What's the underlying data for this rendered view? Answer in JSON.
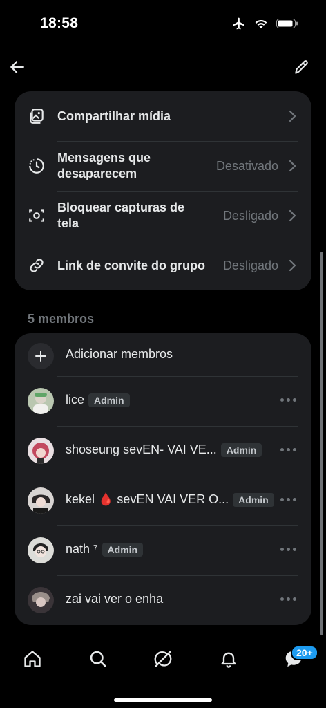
{
  "status_bar": {
    "time": "18:58",
    "icons": [
      "airplane-icon",
      "wifi-icon",
      "battery-icon"
    ]
  },
  "top_bar": {
    "back_icon": "arrow-left-icon",
    "edit_icon": "pencil-icon"
  },
  "settings": [
    {
      "label": "Compartilhar mídia",
      "value": "",
      "icon": "media-icon"
    },
    {
      "label": "Mensagens que desaparecem",
      "value": "Desativado",
      "icon": "timer-icon"
    },
    {
      "label": "Bloquear capturas de tela",
      "value": "Desligado",
      "icon": "camera-block-icon"
    },
    {
      "label": "Link de convite do grupo",
      "value": "Desligado",
      "icon": "link-icon"
    }
  ],
  "members": {
    "count_label": "5 membros",
    "add_label": "Adicionar membros",
    "list": [
      {
        "name": "lice",
        "badge": "Admin"
      },
      {
        "name": "shoseung sevEN- VAI VE...",
        "badge": "Admin"
      },
      {
        "name": "kekel 🩸 sevEN VAI VER O...",
        "badge": "Admin"
      },
      {
        "name": "nath ⁷",
        "badge": "Admin"
      },
      {
        "name": "zai vai ver o enha",
        "badge": ""
      }
    ]
  },
  "bottom_nav": {
    "items": [
      "home-icon",
      "search-icon",
      "grok-icon",
      "bell-icon",
      "messages-icon"
    ],
    "messages_badge": "20+"
  },
  "colors": {
    "background": "#000000",
    "card": "#1c1d20",
    "muted": "#71767b",
    "accent": "#1d9bf0"
  }
}
